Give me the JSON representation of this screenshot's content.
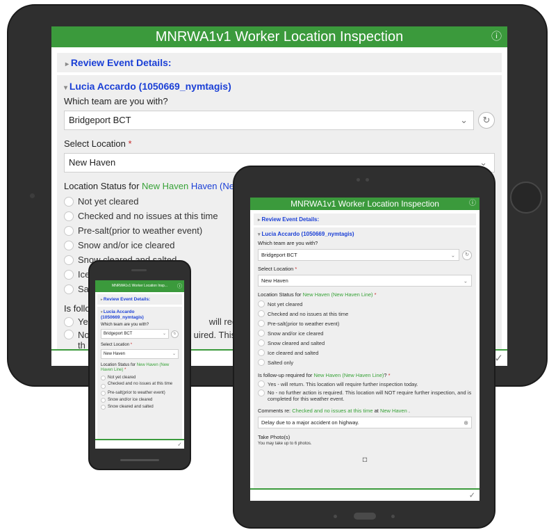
{
  "app_title": "MNRWA1v1 Worker Location Inspection",
  "phone_app_title": "MNRWA1v1 Worker Location Insp...",
  "review_section": "Review Event Details:",
  "user_section": "Lucia Accardo (1050669_nymtagis)",
  "team_question": "Which team are you with?",
  "team_value": "Bridgeport BCT",
  "location_label": "Select Location",
  "required_mark": "*",
  "location_value": "New Haven",
  "status_label_prefix": "Location Status for",
  "status_location": "New Haven",
  "status_line": "(New Haven Line)",
  "status_options": [
    "Not yet cleared",
    "Checked and no issues at this time",
    "Pre-salt(prior to weather event)",
    "Snow and/or ice cleared",
    "Snow cleared and salted",
    "Ice cleared and salted",
    "Salted only"
  ],
  "status_selected_index": 1,
  "followup_label_prefix": "Is follow-up required for",
  "followup_suffix": "?",
  "followup_options": [
    "Yes - will return.  This location will require further inspection today.",
    "No - no further action is required.  This location will NOT require further inspection, and is completed for this weather event."
  ],
  "followup_selected_index": 0,
  "comments_prefix": "Comments re:",
  "comments_status": "Checked and no issues at this time",
  "comments_at": "at",
  "comments_end": ".",
  "comments_value": "Delay due to a major accident on highway.",
  "photo_label": "Take Photo(s)",
  "photo_hint": "You may take up to 6 photos.",
  "fragments": {
    "ice": "Ice",
    "salted": "Sa",
    "is_follow": "Is follo",
    "ye": "Ye",
    "no": "No",
    "th": "th",
    "will_requi": "will requi",
    "haven_nev": "Haven (Nev",
    "uired_this": "uired.  This"
  },
  "colors": {
    "header_green": "#3b9a3c",
    "link_blue": "#1a3fd6",
    "value_green": "#37a237",
    "required_red": "#c62828"
  }
}
